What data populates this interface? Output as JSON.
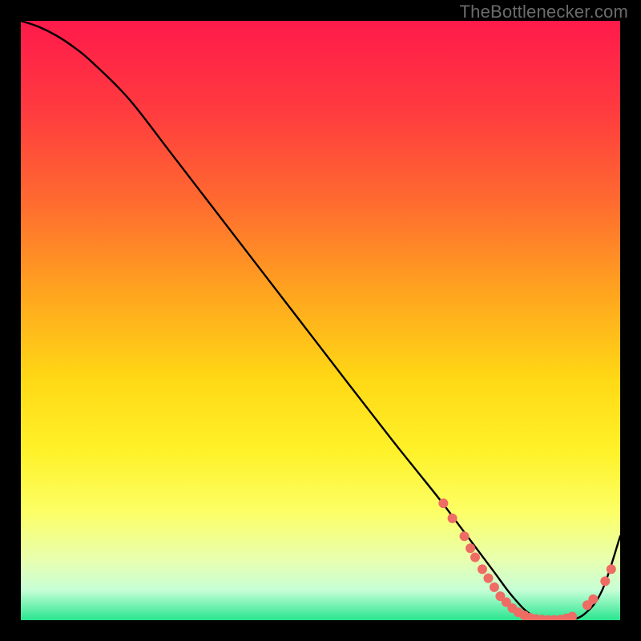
{
  "attribution": {
    "text": "TheBottlenecker.com"
  },
  "chart_data": {
    "type": "line",
    "title": "",
    "xlabel": "",
    "ylabel": "",
    "xlim": [
      0,
      100
    ],
    "ylim": [
      0,
      100
    ],
    "grid": false,
    "background_gradient": {
      "stops": [
        {
          "offset": 0.0,
          "color": "#ff1a4b"
        },
        {
          "offset": 0.15,
          "color": "#ff3b3f"
        },
        {
          "offset": 0.3,
          "color": "#ff6a30"
        },
        {
          "offset": 0.45,
          "color": "#ffa31f"
        },
        {
          "offset": 0.6,
          "color": "#ffd915"
        },
        {
          "offset": 0.72,
          "color": "#fff22a"
        },
        {
          "offset": 0.82,
          "color": "#fcff66"
        },
        {
          "offset": 0.9,
          "color": "#e8ffb0"
        },
        {
          "offset": 0.95,
          "color": "#c6ffd6"
        },
        {
          "offset": 1.0,
          "color": "#29e58f"
        }
      ]
    },
    "series": [
      {
        "name": "bottleneck-curve",
        "type": "line",
        "color": "#000000",
        "x": [
          0,
          3,
          6,
          9,
          12,
          18,
          25,
          35,
          45,
          55,
          62,
          66,
          70,
          73,
          76,
          79,
          82,
          85,
          88,
          91,
          94,
          97,
          100
        ],
        "y": [
          100,
          99,
          97.5,
          95.5,
          93,
          87,
          78,
          65,
          52,
          39,
          30,
          25,
          20,
          16,
          12,
          8,
          4,
          1,
          0,
          0,
          1,
          5,
          14
        ]
      }
    ],
    "markers": {
      "name": "curve-dots",
      "color": "#ee6c64",
      "radius": 6,
      "points": [
        {
          "x": 70.5,
          "y": 19.5
        },
        {
          "x": 72.0,
          "y": 17.0
        },
        {
          "x": 74.0,
          "y": 14.0
        },
        {
          "x": 75.0,
          "y": 12.0
        },
        {
          "x": 75.8,
          "y": 10.5
        },
        {
          "x": 77.0,
          "y": 8.5
        },
        {
          "x": 78.0,
          "y": 7.0
        },
        {
          "x": 79.0,
          "y": 5.5
        },
        {
          "x": 80.0,
          "y": 4.0
        },
        {
          "x": 81.0,
          "y": 3.0
        },
        {
          "x": 82.0,
          "y": 2.0
        },
        {
          "x": 83.0,
          "y": 1.3
        },
        {
          "x": 84.0,
          "y": 0.8
        },
        {
          "x": 85.0,
          "y": 0.4
        },
        {
          "x": 86.0,
          "y": 0.2
        },
        {
          "x": 87.0,
          "y": 0.1
        },
        {
          "x": 88.0,
          "y": 0.05
        },
        {
          "x": 89.0,
          "y": 0.05
        },
        {
          "x": 90.0,
          "y": 0.1
        },
        {
          "x": 91.0,
          "y": 0.3
        },
        {
          "x": 92.0,
          "y": 0.6
        },
        {
          "x": 94.5,
          "y": 2.5
        },
        {
          "x": 95.5,
          "y": 3.5
        },
        {
          "x": 97.5,
          "y": 6.5
        },
        {
          "x": 98.5,
          "y": 8.5
        }
      ]
    }
  }
}
